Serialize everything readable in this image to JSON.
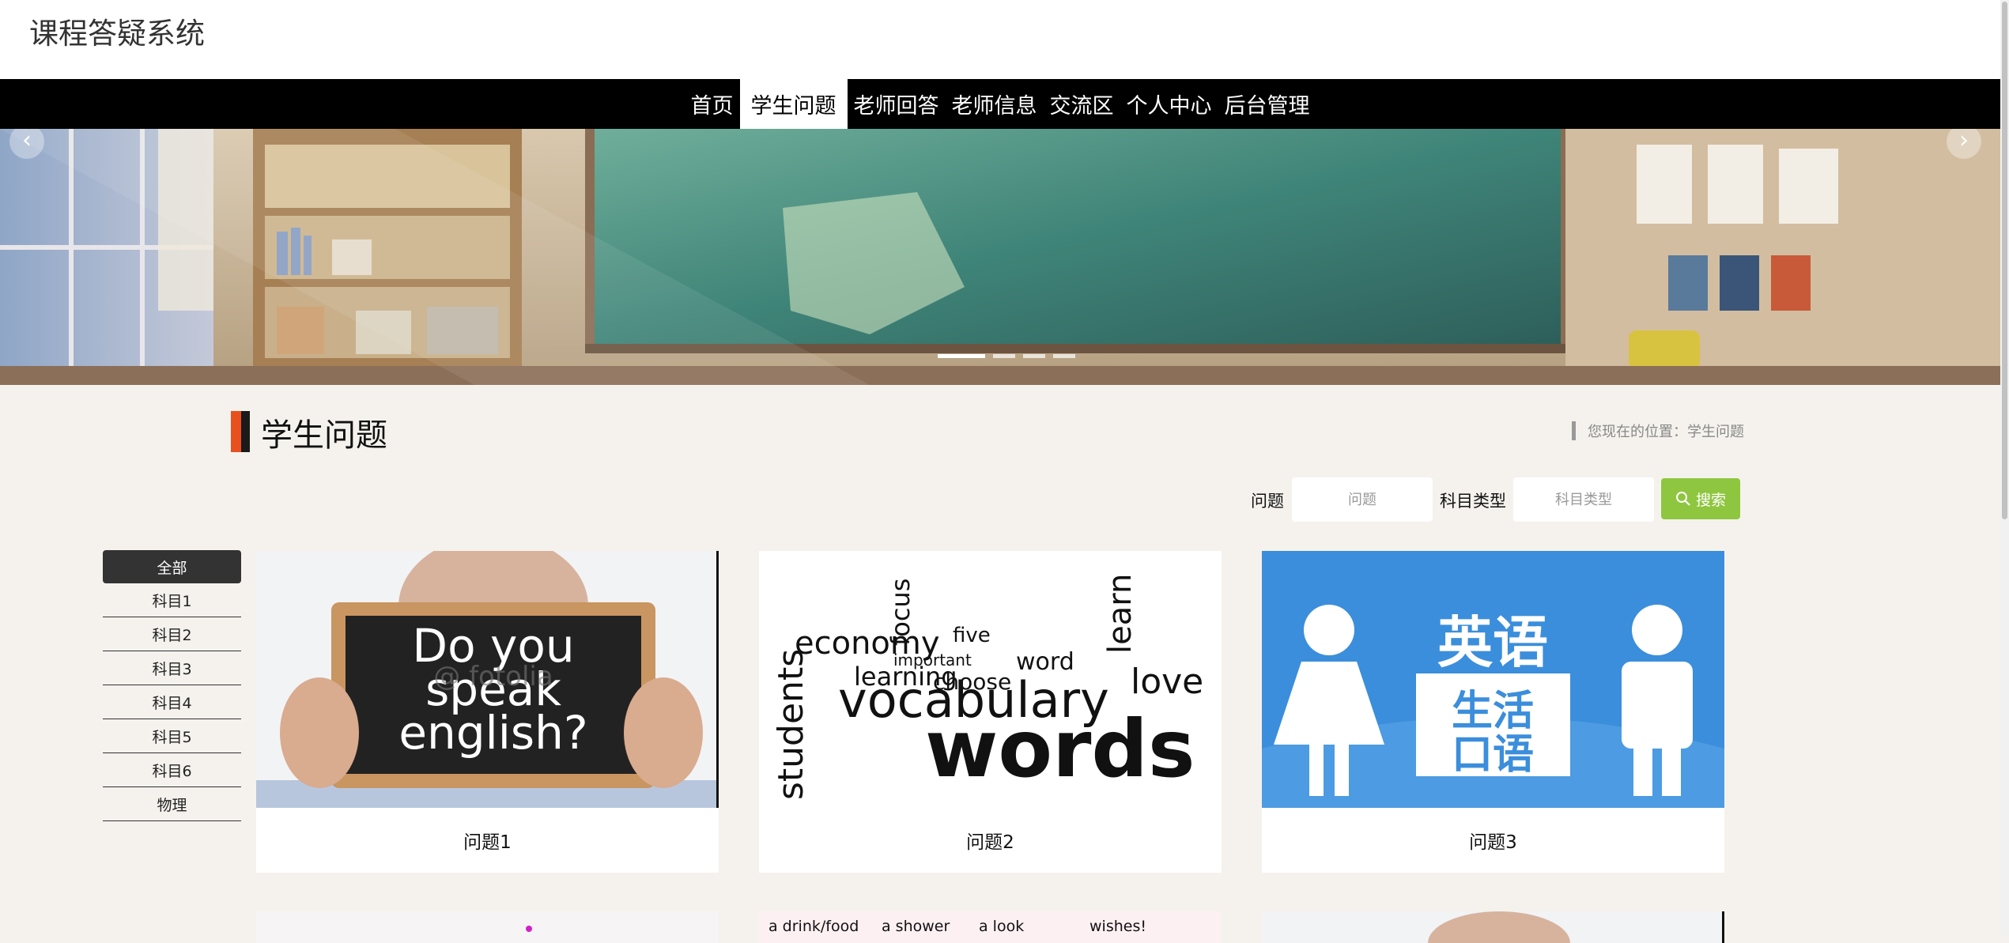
{
  "site": {
    "title": "课程答疑系统"
  },
  "nav": {
    "items": [
      {
        "label": "首页",
        "active": false
      },
      {
        "label": "学生问题",
        "active": true
      },
      {
        "label": "老师回答",
        "active": false
      },
      {
        "label": "老师信息",
        "active": false
      },
      {
        "label": "交流区",
        "active": false
      },
      {
        "label": "个人中心",
        "active": false
      },
      {
        "label": "后台管理",
        "active": false
      }
    ]
  },
  "banner": {
    "prev_icon": "‹",
    "next_icon": "›",
    "dot_count": 4,
    "active_dot": 1
  },
  "section": {
    "title": "学生问题",
    "breadcrumb": "您现在的位置：学生问题"
  },
  "search": {
    "question_label": "问题",
    "question_placeholder": "问题",
    "subject_label": "科目类型",
    "subject_placeholder": "科目类型",
    "button_label": "搜索",
    "button_icon": "search-icon"
  },
  "categories": [
    "全部",
    "科目1",
    "科目2",
    "科目3",
    "科目4",
    "科目5",
    "科目6",
    "物理"
  ],
  "active_category": 0,
  "cards": [
    {
      "caption": "问题1",
      "image_text": [
        "Do you",
        "speak",
        "english?"
      ],
      "watermark": "@ fotolia"
    },
    {
      "caption": "问题2",
      "image_text": [
        "economy",
        "vocabulary",
        "words",
        "learning",
        "students",
        "choose",
        "word",
        "focus",
        "five",
        "important",
        "love",
        "learn"
      ]
    },
    {
      "caption": "问题3",
      "image_text": [
        "英语",
        "生活",
        "口语"
      ]
    }
  ],
  "cards_row2_text": [
    "a drink/food",
    "a shower",
    "a look",
    "wishes!"
  ],
  "colors": {
    "accent_orange": "#e8501e",
    "nav_bg": "#000000",
    "search_green": "#8ec63f",
    "page_bg": "#f5f2ed",
    "card3_blue": "#3b8edb"
  }
}
